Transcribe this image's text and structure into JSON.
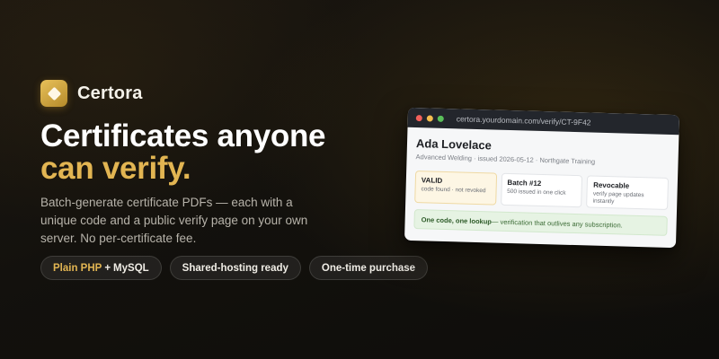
{
  "brand": {
    "name": "Certora",
    "logo_icon": "diamond-icon",
    "logo_color": "#d4a53c"
  },
  "headline": {
    "line1": "Certificates anyone",
    "line2": "can verify.",
    "accent_color": "#e2b552"
  },
  "description": "Batch-generate certificate PDFs — each with a unique code and a public verify page on your own server. No per-certificate fee.",
  "pills": [
    {
      "accent": "Plain PHP",
      "separator": "+",
      "rest": "MySQL"
    },
    {
      "label": "Shared-hosting ready"
    },
    {
      "label": "One-time purchase"
    }
  ],
  "browser": {
    "url": "certora.yourdomain.com/verify/CT-9F42",
    "certificate": {
      "name": "Ada Lovelace",
      "meta": "Advanced Welding · issued 2026-05-12 · Northgate Training"
    },
    "cards": [
      {
        "title": "VALID",
        "subtitle": "code found · not revoked"
      },
      {
        "title": "Batch #12",
        "subtitle": "500 issued in one click"
      },
      {
        "title": "Revocable",
        "subtitle": "verify page updates instantly"
      }
    ],
    "strip": {
      "bold": "One code, one lookup",
      "rest": " — verification that outlives any subscription."
    }
  }
}
